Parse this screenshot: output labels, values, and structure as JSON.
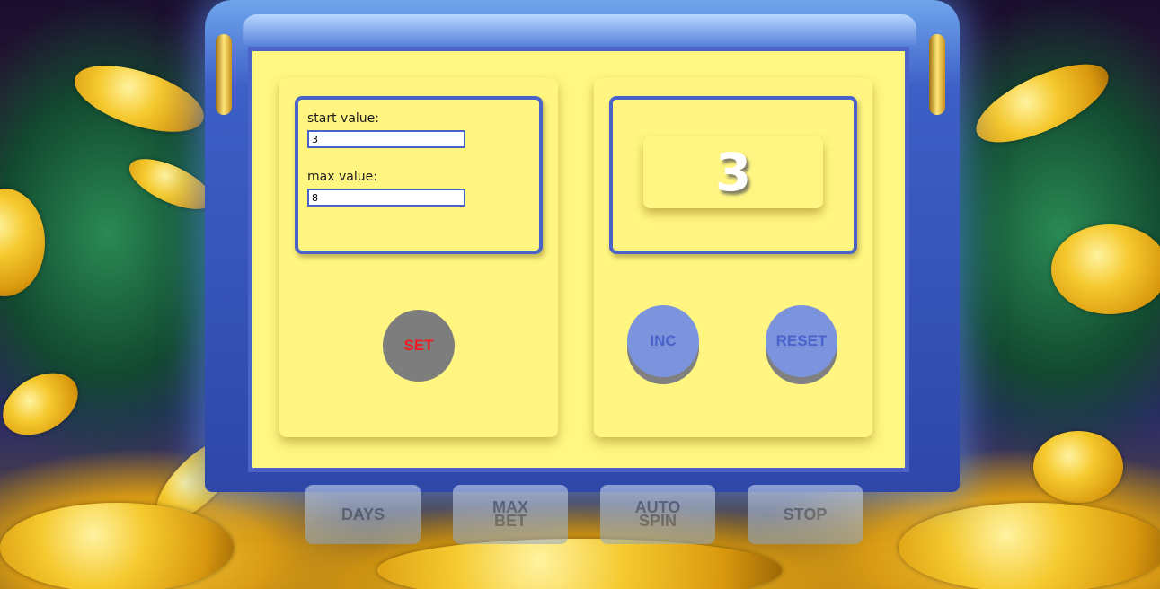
{
  "background": {
    "bottom_keys": [
      "DAYS",
      "MAX\nBET",
      "AUTO\nSPIN",
      "STOP"
    ]
  },
  "settings": {
    "start_label": "start value:",
    "start_value": "3",
    "max_label": "max value:",
    "max_value": "8",
    "set_button": "SET"
  },
  "counter": {
    "value": "3",
    "inc_button": "INC",
    "reset_button": "RESET"
  },
  "colors": {
    "panel_bg": "#fff782",
    "border": "#4a63c9",
    "set_text": "#ee1d23",
    "blue_button": "#7b94dd"
  }
}
